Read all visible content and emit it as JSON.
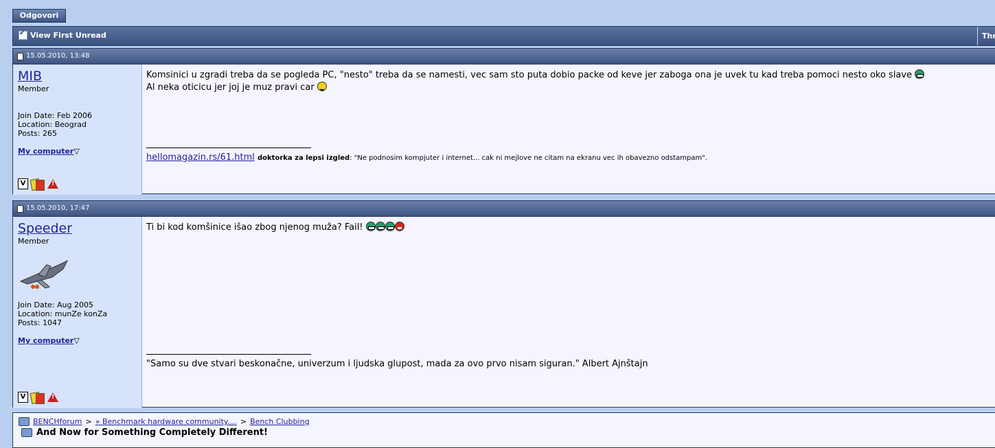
{
  "toolbar": {
    "reply_label": "Odgovori",
    "view_first_unread": "View First Unread",
    "thread_tools": "Thr"
  },
  "posts": [
    {
      "date": "15.05.2010, 13:48",
      "username": "MIB",
      "usertitle": "Member",
      "join_date": "Join Date: Feb 2006",
      "location": "Location: Beograd",
      "posts": "Posts: 265",
      "my_computer": "My computer",
      "message_line1": "Komsinici u zgradi treba da se pogleda PC, \"nesto\" treba da se namesti, vec sam sto puta dobio packe od keve jer zaboga ona je uvek tu kad treba pomoci nesto oko slave",
      "message_line2": "Al neka oticicu jer joj je muz pravi car",
      "sig_link": "hellomagazin.rs/61.html",
      "sig_name": "doktorka za lepsi izgled",
      "sig_quote": ": \"Ne podnosim kompjuter i internet... cak ni mejlove ne citam na ekranu vec ih obavezno odstampam\"."
    },
    {
      "date": "15.05.2010, 17:47",
      "username": "Speeder",
      "usertitle": "Member",
      "join_date": "Join Date: Aug 2005",
      "location": "Location: munZe konZa",
      "posts": "Posts: 1047",
      "my_computer": "My computer",
      "message_line1": "Ti bi kod komšinice išao zbog njenog muža? Fail!",
      "signature": "\"Samo su dve stvari beskonačne, univerzum i ljudska glupost, mada za ovo prvo nisam siguran.\" Albert Ajnštajn"
    }
  ],
  "breadcrumb": {
    "items": [
      "BENCHforum",
      "» Benchmark hardware community....",
      "Bench Clubbing"
    ],
    "separator": ">",
    "thread_title": "And Now for Something Completely Different!"
  }
}
